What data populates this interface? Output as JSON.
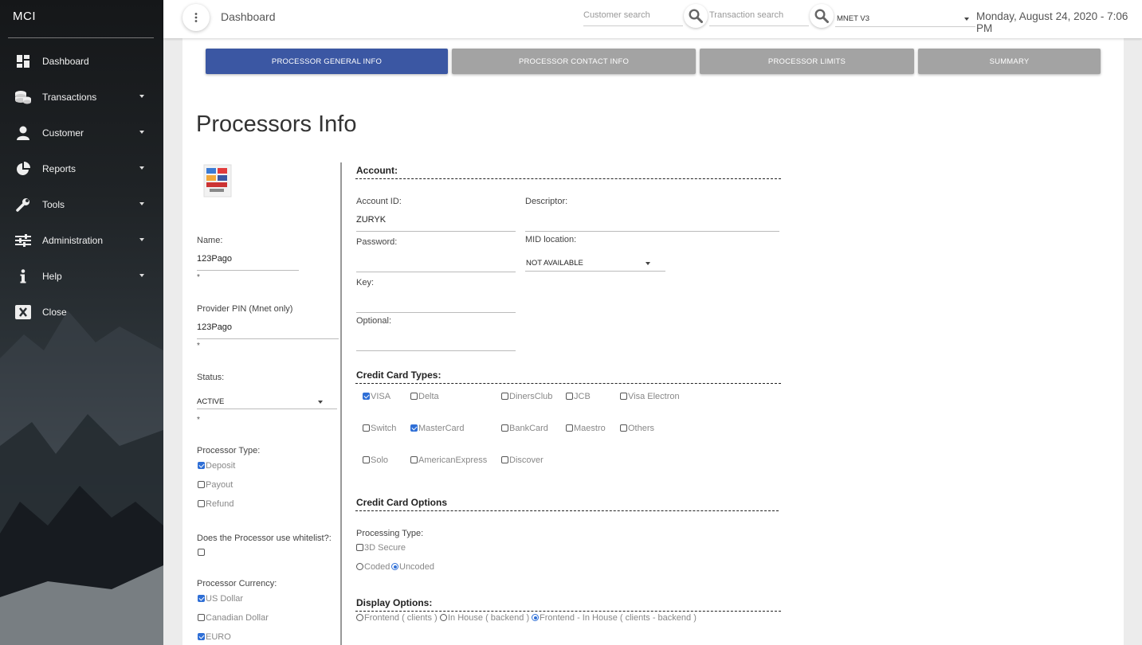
{
  "app": {
    "brand": "MCI"
  },
  "sidebar": {
    "items": [
      {
        "label": "Dashboard",
        "icon": "dashboard-icon",
        "has_submenu": false
      },
      {
        "label": "Transactions",
        "icon": "coins-stack-icon",
        "has_submenu": true
      },
      {
        "label": "Customer",
        "icon": "user-icon",
        "has_submenu": true
      },
      {
        "label": "Reports",
        "icon": "pie-chart-icon",
        "has_submenu": true
      },
      {
        "label": "Tools",
        "icon": "wrench-icon",
        "has_submenu": true
      },
      {
        "label": "Administration",
        "icon": "sliders-icon",
        "has_submenu": true
      },
      {
        "label": "Help",
        "icon": "info-icon",
        "has_submenu": true
      },
      {
        "label": "Close",
        "icon": "close-box-icon",
        "has_submenu": false
      }
    ]
  },
  "header": {
    "title": "Dashboard",
    "customer_search_placeholder": "Customer search",
    "transaction_search_placeholder": "Transaction search",
    "environment": "MNET V3",
    "datetime": "Monday, August 24, 2020 - 7:06 PM"
  },
  "tabs": [
    {
      "label": "PROCESSOR GENERAL INFO",
      "active": true
    },
    {
      "label": "PROCESSOR CONTACT INFO",
      "active": false
    },
    {
      "label": "PROCESSOR LIMITS",
      "active": false
    },
    {
      "label": "SUMMARY",
      "active": false
    }
  ],
  "page": {
    "title": "Processors Info"
  },
  "left": {
    "name_label": "Name:",
    "name_value": "123Pago",
    "pin_label": "Provider PIN (Mnet only)",
    "pin_value": "123Pago",
    "required_mark": "*",
    "status_label": "Status:",
    "status_value": "ACTIVE",
    "processor_type_label": "Processor Type:",
    "processor_types": [
      {
        "label": "Deposit",
        "checked": true
      },
      {
        "label": "Payout",
        "checked": false
      },
      {
        "label": "Refund",
        "checked": false
      }
    ],
    "whitelist_label": "Does the Processor use whitelist?:",
    "whitelist_checked": false,
    "currency_label": "Processor Currency:",
    "currencies": [
      {
        "label": "US Dollar",
        "checked": true
      },
      {
        "label": "Canadian Dollar",
        "checked": false
      },
      {
        "label": "EURO",
        "checked": true
      }
    ]
  },
  "account": {
    "section_title": "Account:",
    "account_id_label": "Account ID:",
    "account_id_value": "ZURYK",
    "descriptor_label": "Descriptor:",
    "descriptor_value": "",
    "password_label": "Password:",
    "mid_location_label": "MID location:",
    "mid_location_value": "NOT AVAILABLE",
    "key_label": "Key:",
    "optional_label": "Optional:"
  },
  "credit_card_types": {
    "section_title": "Credit Card Types:",
    "rows": [
      [
        {
          "label": "VISA",
          "checked": true
        },
        {
          "label": "Delta",
          "checked": false
        },
        {
          "label": "DinersClub",
          "checked": false
        },
        {
          "label": "JCB",
          "checked": false
        },
        {
          "label": "Visa Electron",
          "checked": false
        }
      ],
      [
        {
          "label": "Switch",
          "checked": false
        },
        {
          "label": "MasterCard",
          "checked": true
        },
        {
          "label": "BankCard",
          "checked": false
        },
        {
          "label": "Maestro",
          "checked": false
        },
        {
          "label": "Others",
          "checked": false
        }
      ],
      [
        {
          "label": "Solo",
          "checked": false
        },
        {
          "label": "AmericanExpress",
          "checked": false
        },
        {
          "label": "Discover",
          "checked": false
        }
      ]
    ]
  },
  "credit_card_options": {
    "section_title": "Credit Card Options",
    "processing_type_label": "Processing Type:",
    "secure_3d": {
      "label": "3D Secure",
      "checked": false
    },
    "coding": [
      {
        "label": "Coded",
        "selected": false
      },
      {
        "label": "Uncoded",
        "selected": true
      }
    ]
  },
  "display_options": {
    "section_title": "Display Options:",
    "options": [
      {
        "label": "Frontend ( clients )",
        "selected": false
      },
      {
        "label": "In House ( backend )",
        "selected": false
      },
      {
        "label": "Frontend - In House ( clients - backend )",
        "selected": true
      }
    ]
  }
}
